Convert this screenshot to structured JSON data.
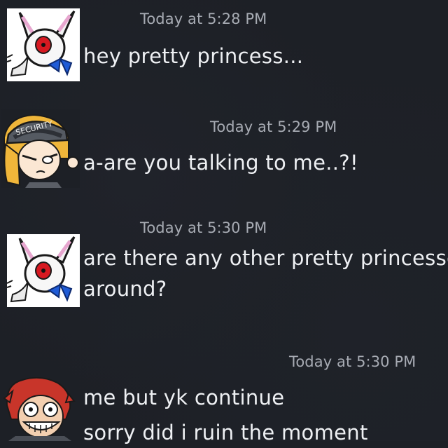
{
  "messages": [
    {
      "id": "m1",
      "avatar_icon": "bunny-animatronic-avatar-icon",
      "timestamp": "Today at 5:28 PM",
      "lines": [
        "hey pretty princess..."
      ]
    },
    {
      "id": "m2",
      "avatar_icon": "security-guard-avatar-icon",
      "timestamp": "Today at 5:29 PM",
      "lines": [
        "a-are you talking to me..?!"
      ]
    },
    {
      "id": "m3",
      "avatar_icon": "bunny-animatronic-avatar-icon",
      "timestamp": "Today at 5:30 PM",
      "lines": [
        "are there any other pretty princesses",
        "around?"
      ]
    },
    {
      "id": "m4",
      "avatar_icon": "red-haired-grinning-avatar-icon",
      "timestamp": "Today at 5:30 PM",
      "lines": [
        "me but yk continue",
        "sorry did i ruin the moment"
      ]
    }
  ],
  "colors": {
    "background": "#1d2026",
    "text": "#eef0f3",
    "timestamp": "#a7abb3"
  }
}
